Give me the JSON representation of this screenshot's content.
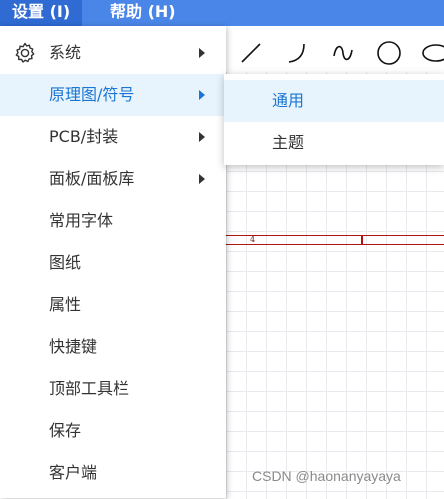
{
  "menubar": {
    "settings_label": "设置 (I)",
    "help_label": "帮助 (H)"
  },
  "dropdown": {
    "items": [
      {
        "label": "系统",
        "submenu": true,
        "icon": "gear-icon"
      },
      {
        "label": "原理图/符号",
        "submenu": true,
        "highlighted": true
      },
      {
        "label": "PCB/封装",
        "submenu": true
      },
      {
        "label": "面板/面板库",
        "submenu": true
      },
      {
        "label": "常用字体"
      },
      {
        "label": "图纸"
      },
      {
        "label": "属性"
      },
      {
        "label": "快捷键"
      },
      {
        "label": "顶部工具栏"
      },
      {
        "label": "保存"
      },
      {
        "label": "客户端"
      }
    ]
  },
  "submenu": {
    "items": [
      {
        "label": "通用",
        "highlighted": true
      },
      {
        "label": "主题"
      }
    ]
  },
  "canvas": {
    "wire_label": "4",
    "tools": [
      "line-tool-icon",
      "arc-tool-icon",
      "bezier-tool-icon",
      "circle-tool-icon",
      "ellipse-tool-icon"
    ]
  },
  "watermark": "CSDN @haonanyayaya",
  "colors": {
    "menubar": "#4a86e8",
    "highlight_bg": "#e8f4fd",
    "highlight_text": "#1a76d2",
    "wire": "#b01515"
  }
}
